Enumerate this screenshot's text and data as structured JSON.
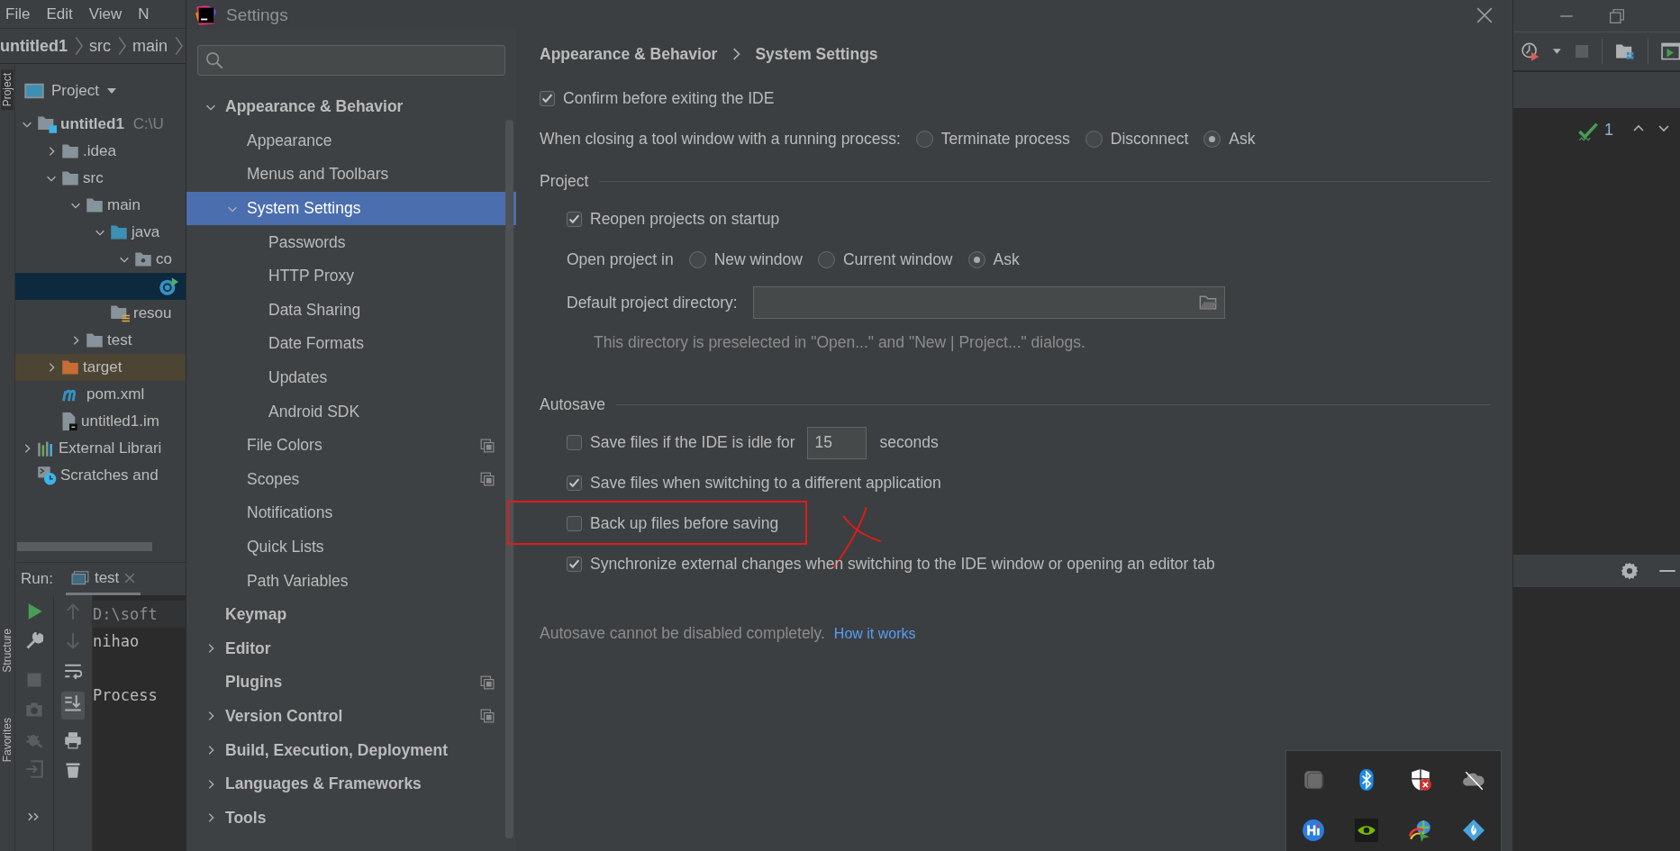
{
  "ide_menu": [
    "File",
    "Edit",
    "View",
    "N"
  ],
  "ide_breadcrumb": [
    "untitled1",
    "src",
    "main"
  ],
  "tool_stripe": [
    {
      "label": "Project",
      "selected": true
    },
    {
      "label": "Structure",
      "selected": false
    },
    {
      "label": "Favorites",
      "selected": false
    }
  ],
  "project_panel": {
    "title": "Project",
    "tree": [
      {
        "label": "untitled1",
        "path": "C:\\U",
        "kind": "module",
        "expanded": true,
        "selected": false,
        "children": [
          {
            "label": ".idea",
            "kind": "folder",
            "expanded": false,
            "selected": false
          },
          {
            "label": "src",
            "kind": "folder",
            "expanded": true,
            "selected": false,
            "children": [
              {
                "label": "main",
                "kind": "folder",
                "expanded": true,
                "selected": false,
                "children": [
                  {
                    "label": "java",
                    "kind": "source-folder",
                    "expanded": true,
                    "selected": false,
                    "children": [
                      {
                        "label": "co",
                        "kind": "package",
                        "expanded": true,
                        "selected": false,
                        "children": [
                          {
                            "kind": "class",
                            "selected": true
                          }
                        ]
                      }
                    ]
                  },
                  {
                    "label": "resou",
                    "kind": "resources",
                    "selected": false
                  }
                ]
              },
              {
                "label": "test",
                "kind": "folder",
                "expanded": false,
                "selected": false
              }
            ]
          },
          {
            "label": "target",
            "kind": "excluded-folder",
            "expanded": false,
            "selected": false
          },
          {
            "label": "pom.xml",
            "kind": "maven",
            "selected": false
          },
          {
            "label": "untitled1.im",
            "kind": "module-file",
            "selected": false
          }
        ]
      },
      {
        "label": "External Librari",
        "kind": "libraries",
        "expanded": false,
        "selected": false
      },
      {
        "label": "Scratches and",
        "kind": "scratches",
        "selected": false
      }
    ]
  },
  "run_panel": {
    "label": "Run:",
    "tab": "test",
    "console": [
      {
        "text": "D:\\soft",
        "kind": "command"
      },
      {
        "text": "nihao",
        "kind": "output"
      },
      {
        "text": "Process",
        "kind": "exit"
      }
    ]
  },
  "settings": {
    "title": "Settings",
    "nav": [
      {
        "label": "Appearance & Behavior",
        "expanded": true,
        "selected": false,
        "scoped": false,
        "children": [
          {
            "label": "Appearance",
            "selected": false,
            "scoped": false
          },
          {
            "label": "Menus and Toolbars",
            "selected": false,
            "scoped": false
          },
          {
            "label": "System Settings",
            "expanded": true,
            "selected": true,
            "scoped": false,
            "children": [
              {
                "label": "Passwords",
                "selected": false,
                "scoped": false
              },
              {
                "label": "HTTP Proxy",
                "selected": false,
                "scoped": false
              },
              {
                "label": "Data Sharing",
                "selected": false,
                "scoped": false
              },
              {
                "label": "Date Formats",
                "selected": false,
                "scoped": false
              },
              {
                "label": "Updates",
                "selected": false,
                "scoped": false
              },
              {
                "label": "Android SDK",
                "selected": false,
                "scoped": false
              }
            ]
          },
          {
            "label": "File Colors",
            "selected": false,
            "scoped": true
          },
          {
            "label": "Scopes",
            "selected": false,
            "scoped": true
          },
          {
            "label": "Notifications",
            "selected": false,
            "scoped": false
          },
          {
            "label": "Quick Lists",
            "selected": false,
            "scoped": false
          },
          {
            "label": "Path Variables",
            "selected": false,
            "scoped": false
          }
        ]
      },
      {
        "label": "Keymap",
        "selected": false,
        "scoped": false
      },
      {
        "label": "Editor",
        "expanded": false,
        "selected": false,
        "scoped": false
      },
      {
        "label": "Plugins",
        "selected": false,
        "scoped": true
      },
      {
        "label": "Version Control",
        "expanded": false,
        "selected": false,
        "scoped": true
      },
      {
        "label": "Build, Execution, Deployment",
        "expanded": false,
        "selected": false,
        "scoped": false
      },
      {
        "label": "Languages & Frameworks",
        "expanded": false,
        "selected": false,
        "scoped": false
      },
      {
        "label": "Tools",
        "expanded": false,
        "selected": false,
        "scoped": false
      }
    ],
    "breadcrumb": [
      "Appearance & Behavior",
      "System Settings"
    ],
    "sections": [
      {
        "rows": [
          {
            "kind": "checkbox",
            "label": "Confirm before exiting the IDE",
            "checked": true
          },
          {
            "kind": "radio-group",
            "label": "When closing a tool window with a running process:",
            "options": [
              {
                "label": "Terminate process",
                "selected": false
              },
              {
                "label": "Disconnect",
                "selected": false
              },
              {
                "label": "Ask",
                "selected": true
              }
            ]
          }
        ]
      },
      {
        "title": "Project",
        "rows": [
          {
            "kind": "checkbox",
            "label": "Reopen projects on startup",
            "checked": true
          },
          {
            "kind": "radio-group",
            "label": "Open project in",
            "options": [
              {
                "label": "New window",
                "selected": false
              },
              {
                "label": "Current window",
                "selected": false
              },
              {
                "label": "Ask",
                "selected": true
              }
            ]
          },
          {
            "kind": "path-field",
            "label": "Default project directory:"
          },
          {
            "kind": "hint",
            "text": "This directory is preselected in \"Open...\" and \"New | Project...\" dialogs."
          }
        ]
      },
      {
        "title": "Autosave",
        "rows": [
          {
            "kind": "checkbox-number",
            "label": "Save files if the IDE is idle for",
            "checked": false,
            "value": "15",
            "unit": "seconds"
          },
          {
            "kind": "checkbox",
            "label": "Save files when switching to a different application",
            "checked": true
          },
          {
            "kind": "checkbox",
            "label": "Back up files before saving",
            "checked": false,
            "annotated": true
          },
          {
            "kind": "checkbox",
            "label": "Synchronize external changes when switching to the IDE window or opening an editor tab",
            "checked": true
          }
        ]
      }
    ],
    "footer": {
      "text": "Autosave cannot be disabled completely.",
      "link": "How it works"
    }
  },
  "inspection": {
    "count": "1"
  }
}
